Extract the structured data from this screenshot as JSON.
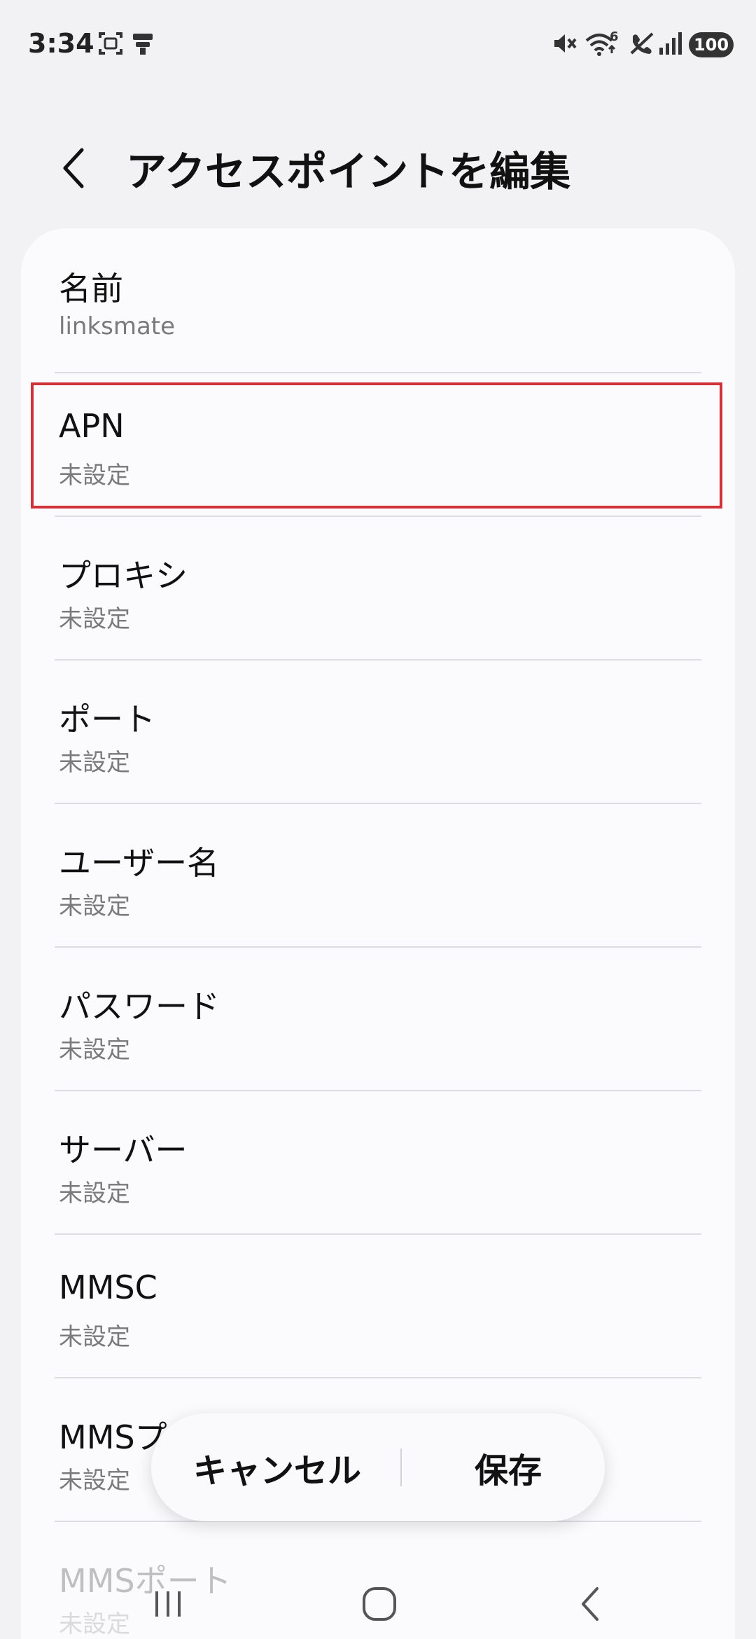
{
  "status_bar": {
    "time": "3:34",
    "battery": "100",
    "icons": [
      "screenshot-icon",
      "notification-icon",
      "mute-icon",
      "wifi-icon",
      "call-off-icon",
      "signal-icon"
    ],
    "wifi_badge": "6"
  },
  "header": {
    "title": "アクセスポイントを編集",
    "back_icon": "chevron-left-icon"
  },
  "settings": [
    {
      "label": "名前",
      "value": "linksmate"
    },
    {
      "label": "APN",
      "value": "未設定"
    },
    {
      "label": "プロキシ",
      "value": "未設定"
    },
    {
      "label": "ポート",
      "value": "未設定"
    },
    {
      "label": "ユーザー名",
      "value": "未設定"
    },
    {
      "label": "パスワード",
      "value": "未設定"
    },
    {
      "label": "サーバー",
      "value": "未設定"
    },
    {
      "label": "MMSC",
      "value": "未設定"
    },
    {
      "label": "MMSプロキシ",
      "value": "未設定"
    },
    {
      "label": "MMSポート",
      "value": "未設定"
    }
  ],
  "actions": {
    "cancel": "キャンセル",
    "save": "保存"
  },
  "nav": {
    "recent_icon": "recent-apps-icon",
    "home_icon": "home-icon",
    "back_icon": "back-icon"
  },
  "colors": {
    "highlight": "#d0323a",
    "background": "#f2f2f4",
    "card": "#fbfbfd"
  }
}
